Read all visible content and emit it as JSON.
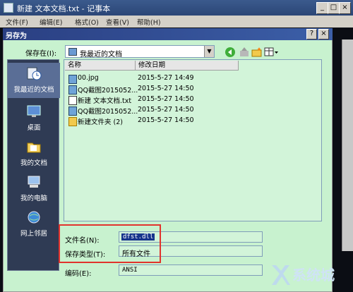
{
  "notepad": {
    "title": "新建 文本文档.txt - 记事本",
    "menu": [
      "文件(F)",
      "编辑(E)",
      "格式(O)",
      "查看(V)",
      "帮助(H)"
    ],
    "caption_buttons": {
      "minimize": "_",
      "maximize": "□",
      "close": "×"
    }
  },
  "dialog": {
    "title": "另存为",
    "help_button": "?",
    "close_button": "×",
    "save_in_label": "保存在(I):",
    "save_in_value": "我最近的文档",
    "places": [
      {
        "label": "我最近的文档",
        "icon": "recent-documents-icon"
      },
      {
        "label": "桌面",
        "icon": "desktop-icon"
      },
      {
        "label": "我的文档",
        "icon": "my-documents-icon"
      },
      {
        "label": "我的电脑",
        "icon": "my-computer-icon"
      },
      {
        "label": "网上邻居",
        "icon": "network-places-icon"
      }
    ],
    "columns": [
      "名称",
      "修改日期"
    ],
    "files": [
      {
        "name": "00.jpg",
        "date": "2015-5-27 14:49",
        "icon": "image-file-icon"
      },
      {
        "name": "QQ截图2015052...",
        "date": "2015-5-27 14:50",
        "icon": "image-file-icon"
      },
      {
        "name": "新建 文本文档.txt",
        "date": "2015-5-27 14:50",
        "icon": "text-file-icon"
      },
      {
        "name": "QQ截图2015052...",
        "date": "2015-5-27 14:50",
        "icon": "image-file-icon"
      },
      {
        "name": "新建文件夹 (2)",
        "date": "2015-5-27 14:50",
        "icon": "folder-icon"
      }
    ],
    "filename_label": "文件名(N):",
    "filename_value": "dfst.dll",
    "filetype_label": "保存类型(T):",
    "filetype_value": "所有文件",
    "encoding_label": "编码(E):",
    "encoding_value": "ANSI"
  },
  "watermark": "系统城"
}
